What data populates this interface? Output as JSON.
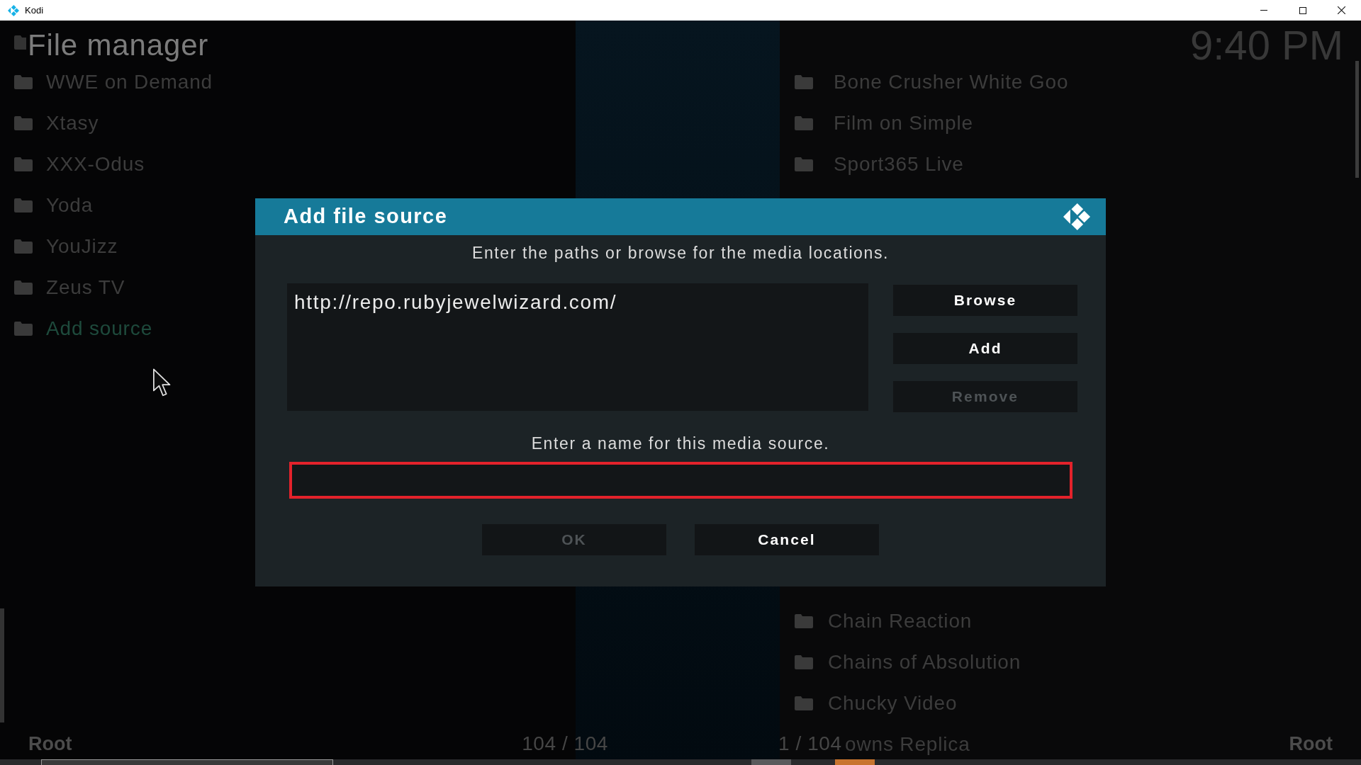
{
  "window": {
    "title": "Kodi"
  },
  "header": {
    "title": "File manager",
    "clock": "9:40 PM"
  },
  "left_pane": {
    "items": [
      {
        "label": "WWE on Demand",
        "selected": false
      },
      {
        "label": "Xtasy",
        "selected": false
      },
      {
        "label": "XXX-Odus",
        "selected": false
      },
      {
        "label": "Yoda",
        "selected": false
      },
      {
        "label": "YouJizz",
        "selected": false
      },
      {
        "label": "Zeus TV",
        "selected": false
      },
      {
        "label": "Add source",
        "selected": true
      }
    ],
    "path": "Root",
    "count": "104 / 104"
  },
  "right_pane": {
    "items_top": [
      {
        "label": "Bone Crusher White Goo",
        "selected": false
      },
      {
        "label": "Film on Simple",
        "selected": false
      },
      {
        "label": "Sport365 Live",
        "selected": false
      }
    ],
    "items_bottom": [
      {
        "label": "Chain Reaction",
        "selected": false
      },
      {
        "label": "Chains of Absolution",
        "selected": false
      },
      {
        "label": "Chucky Video",
        "selected": false
      },
      {
        "label": "owns Replica",
        "selected": false
      }
    ],
    "count": "1 / 104",
    "path": "Root"
  },
  "dialog": {
    "title": "Add file source",
    "paths_prompt": "Enter the paths or browse for the media locations.",
    "paths": [
      {
        "value": "http://repo.rubyjewelwizard.com/"
      }
    ],
    "side_buttons": [
      {
        "label": "Browse",
        "disabled": false
      },
      {
        "label": "Add",
        "disabled": false
      },
      {
        "label": "Remove",
        "disabled": true
      }
    ],
    "name_prompt": "Enter a name for this media source.",
    "name_field": {
      "highlighted": true
    },
    "buttons": [
      {
        "label": "OK",
        "disabled": true
      },
      {
        "label": "Cancel",
        "disabled": false
      }
    ]
  }
}
